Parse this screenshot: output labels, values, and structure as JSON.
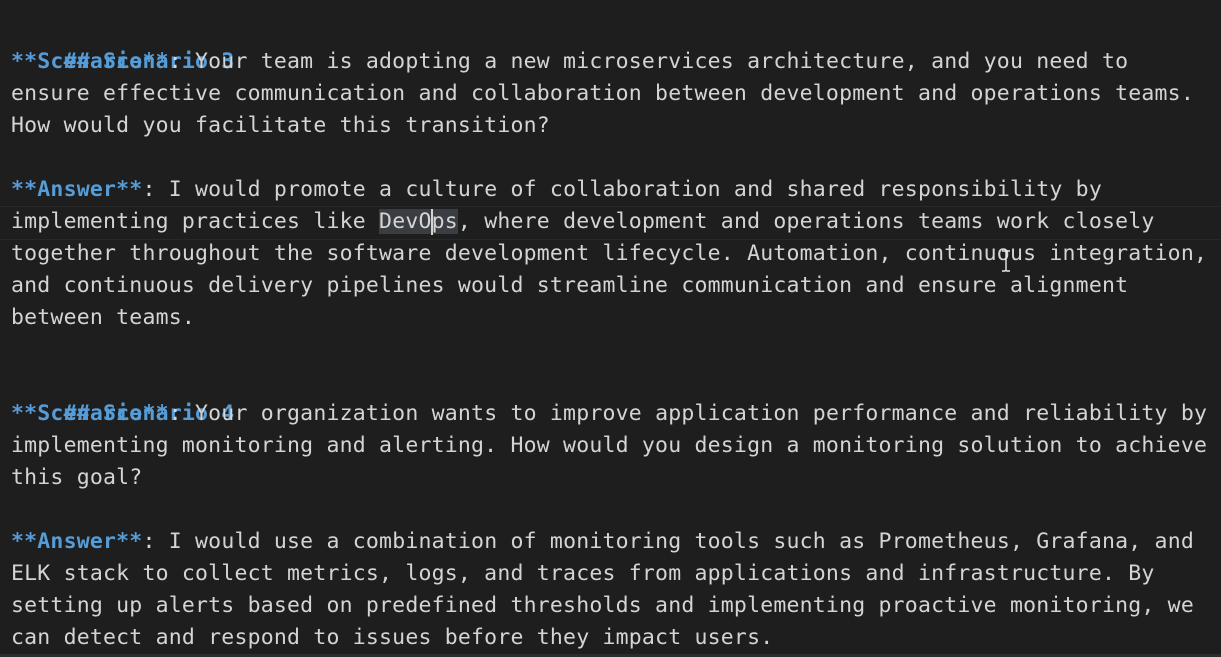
{
  "lines": {
    "s3_heading": "## Scenario 3",
    "s3_scn_marker": "**Scenario**",
    "s3_scn_rest1": ": Your team is adopting a new microservices architecture, and you need to",
    "s3_scn_l2": "ensure effective communication and collaboration between development and operations teams.",
    "s3_scn_l3": "How would you facilitate this transition?",
    "s3_ans_marker": "**Answer**",
    "s3_ans_rest1": ": I would promote a culture of collaboration and shared responsibility by",
    "s3_ans_l2_pre": "implementing practices like ",
    "s3_ans_l2_sel_a": "DevO",
    "s3_ans_l2_sel_b": "ps",
    "s3_ans_l2_post": ", where development and operations teams work closely",
    "s3_ans_l3": "together throughout the software development lifecycle. Automation, continuous integration,",
    "s3_ans_l4": "and continuous delivery pipelines would streamline communication and ensure alignment",
    "s3_ans_l5": "between teams.",
    "s4_heading": "## Scenario 4",
    "s4_scn_marker": "**Scenario**",
    "s4_scn_rest1": ": Your organization wants to improve application performance and reliability by",
    "s4_scn_l2": "implementing monitoring and alerting. How would you design a monitoring solution to achieve",
    "s4_scn_l3": "this goal?",
    "s4_ans_marker": "**Answer**",
    "s4_ans_rest1": ": I would use a combination of monitoring tools such as Prometheus, Grafana, and",
    "s4_ans_l2": "ELK stack to collect metrics, logs, and traces from applications and infrastructure. By",
    "s4_ans_l3": "setting up alerts based on predefined thresholds and implementing proactive monitoring, we",
    "s4_ans_l4": "can detect and respond to issues before they impact users."
  },
  "colors": {
    "background": "#1e1e1e",
    "markdown_emphasis": "#569cd6",
    "text": "#d4d4d4",
    "selection": "#3a3d41"
  },
  "icons": {
    "mouse_cursor": "text-ibeam-cursor"
  }
}
